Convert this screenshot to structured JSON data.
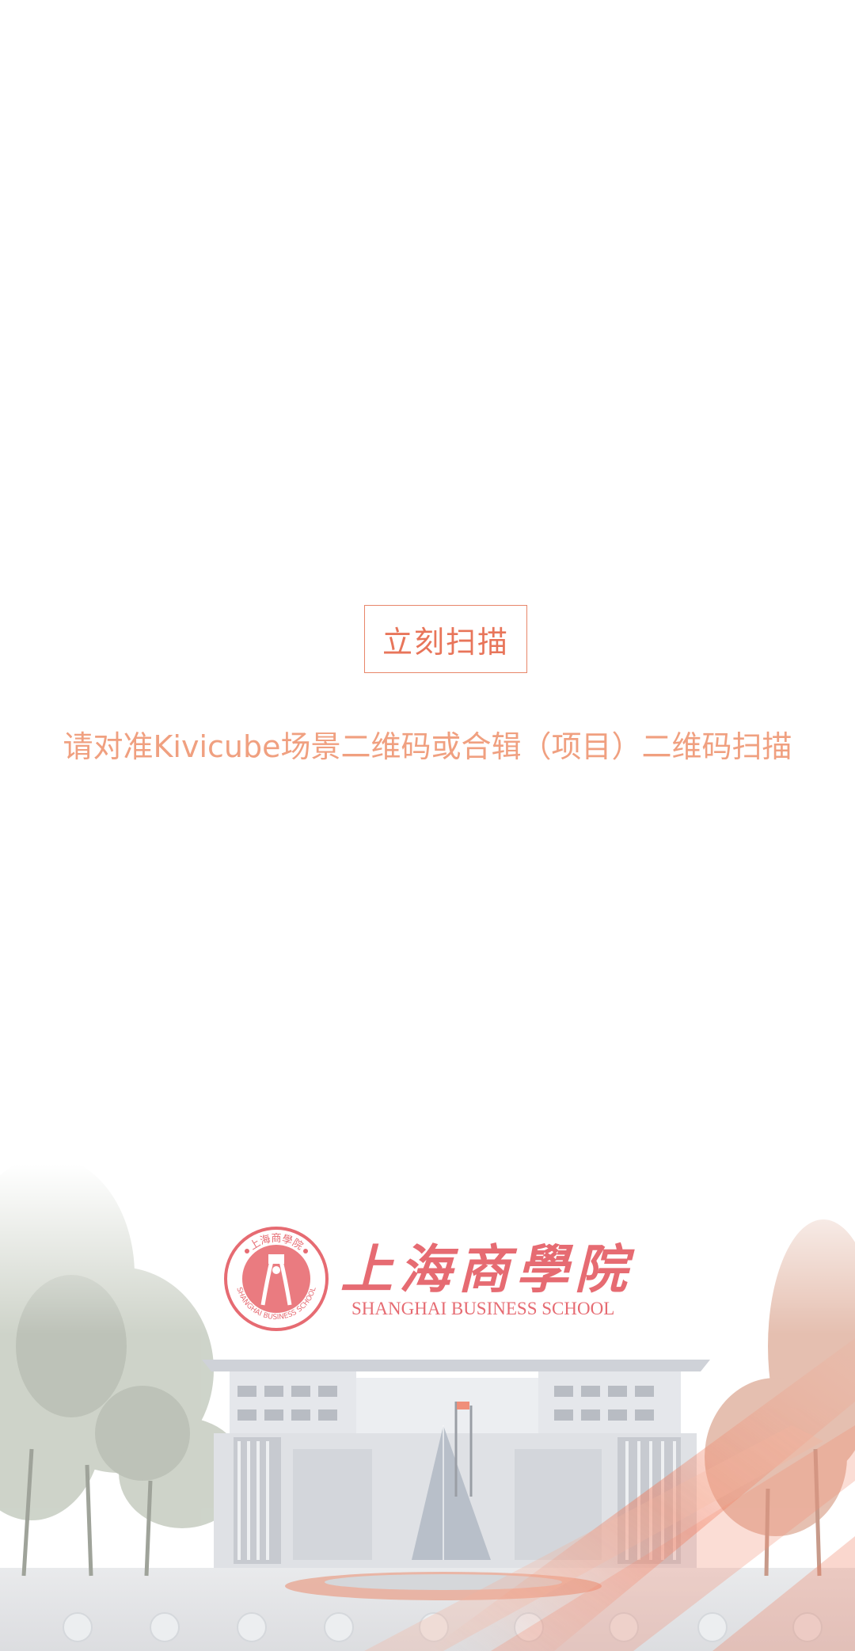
{
  "scan": {
    "button_label": "立刻扫描",
    "hint": "请对准Kivicube场景二维码或合辑（项目）二维码扫描"
  },
  "logo": {
    "name_cn": "上海商學院",
    "name_en": "SHANGHAI BUSINESS SCHOOL",
    "seal_top_text": "上海商學院",
    "seal_bottom_text": "SHANGHAI BUSINESS SCHOOL"
  },
  "colors": {
    "accent": "#e8755a",
    "hint": "#f0a080",
    "logo": "#e66b72"
  },
  "icons": {
    "seal": "school-seal-icon",
    "campus": "campus-building-illustration"
  }
}
